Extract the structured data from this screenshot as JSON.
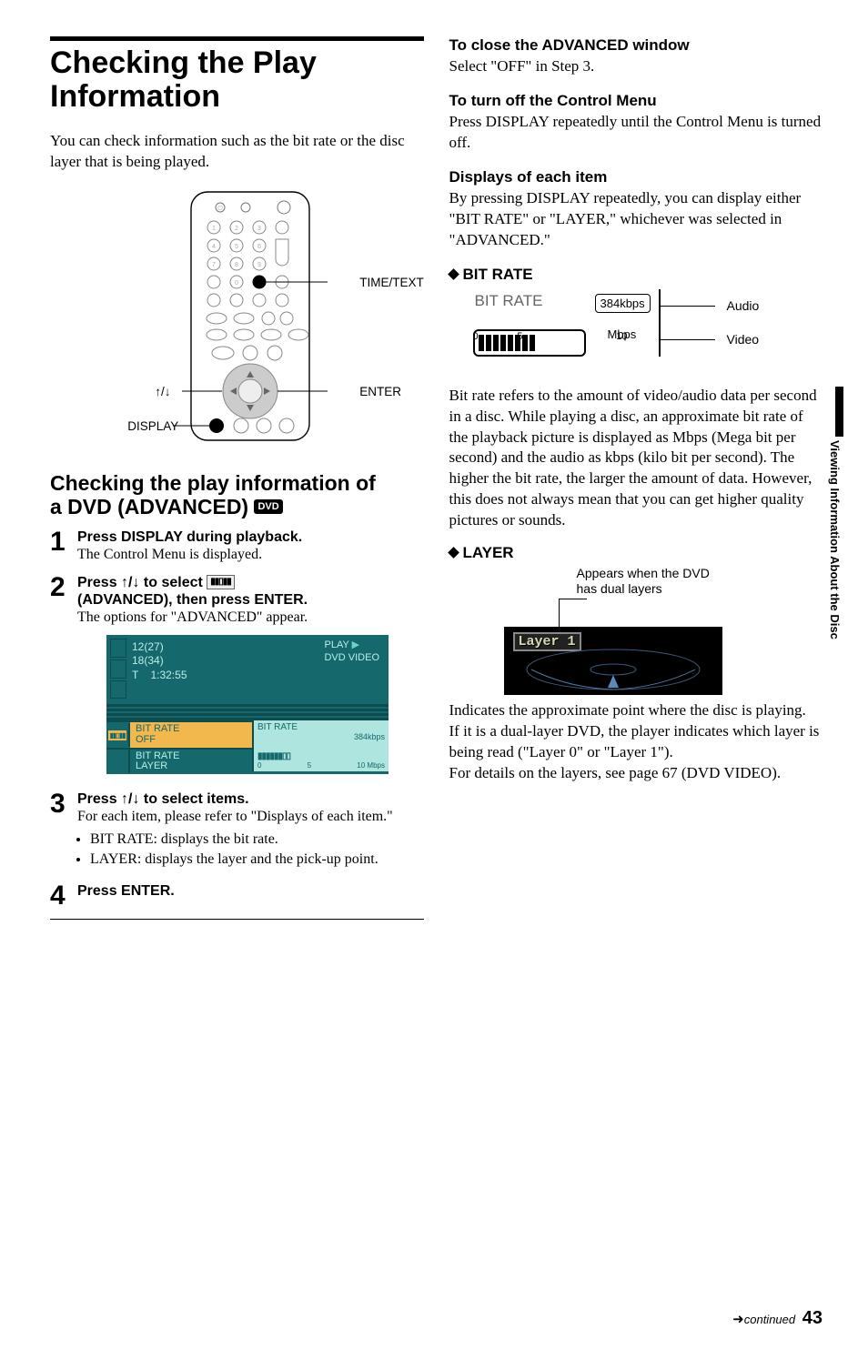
{
  "left": {
    "title": "Checking the Play Information",
    "intro": "You can check information such as the bit rate or the disc layer that is being played.",
    "remote": {
      "label_time": "TIME/TEXT",
      "label_arrows": "↑/↓",
      "label_enter": "ENTER",
      "label_display": "DISPLAY"
    },
    "section2_title_a": "Checking the play information of",
    "section2_title_b": "a DVD (ADVANCED)",
    "dvd_tag": "DVD",
    "steps": [
      {
        "n": "1",
        "head": "Press DISPLAY during playback.",
        "text": "The Control Menu is displayed."
      },
      {
        "n": "2",
        "head_a": "Press ↑/↓ to select ",
        "head_b": " (ADVANCED), then press ENTER.",
        "icon": "▮▮▯▮▮",
        "text": "The options for \"ADVANCED\" appear."
      },
      {
        "n": "3",
        "head": "Press ↑/↓ to select items.",
        "text": "For each item, please refer to \"Displays of each item.\"",
        "bullets": [
          "BIT RATE: displays the bit rate.",
          "LAYER: displays the layer and the pick-up point."
        ]
      },
      {
        "n": "4",
        "head": "Press ENTER."
      }
    ],
    "menu": {
      "line1": "12(27)",
      "line2": "18(34)",
      "line3": "T    1:32:55",
      "play": "PLAY",
      "source": "DVD VIDEO",
      "row1a": "BIT RATE",
      "row1b": "OFF",
      "row2a": "BIT RATE",
      "row2b": "LAYER",
      "right_title": "BIT RATE",
      "right_kbps": "384kbps",
      "right_scale_0": "0",
      "right_scale_5": "5",
      "right_scale_10": "10",
      "right_mbps": "Mbps"
    }
  },
  "right": {
    "s1_h": "To close the ADVANCED window",
    "s1_t": "Select \"OFF\" in Step 3.",
    "s2_h": "To turn off the Control Menu",
    "s2_t": "Press DISPLAY repeatedly until the Control Menu is turned off.",
    "s3_h": "Displays of each item",
    "s3_t": "By pressing DISPLAY repeatedly, you can display either \"BIT RATE\" or \"LAYER,\" whichever was selected in \"ADVANCED.\"",
    "br_h": "BIT RATE",
    "br_title": "BIT RATE",
    "br_kbps": "384kbps",
    "br_s0": "0",
    "br_s5": "5",
    "br_s10": "10",
    "br_mbps": "Mbps",
    "br_audio": "Audio",
    "br_video": "Video",
    "br_para": "Bit rate refers to the amount of video/audio data per second in a disc. While playing a disc, an approximate bit rate of the playback picture is displayed as Mbps (Mega bit per second) and the audio as kbps (kilo bit per second). The higher the bit rate, the larger the amount of data. However, this does not always mean that you can get higher quality pictures or sounds.",
    "ly_h": "LAYER",
    "ly_note1": "Appears when the DVD",
    "ly_note2": "has dual layers",
    "ly_badge": "Layer 1",
    "ly_para": "Indicates the approximate point where the disc is playing.\nIf it is a dual-layer DVD, the player indicates which layer is being read (\"Layer 0\" or \"Layer 1\").\nFor details on the layers, see page 67 (DVD VIDEO)."
  },
  "side_tab": "Viewing Information About the Disc",
  "footer_cont": "continued",
  "footer_page": "43",
  "chart_data": {
    "type": "bar",
    "title": "BIT RATE",
    "audio_kbps": 384,
    "video_scale": {
      "min": 0,
      "mid": 5,
      "max": 10,
      "unit": "Mbps"
    },
    "video_value_approx": 4.5
  }
}
